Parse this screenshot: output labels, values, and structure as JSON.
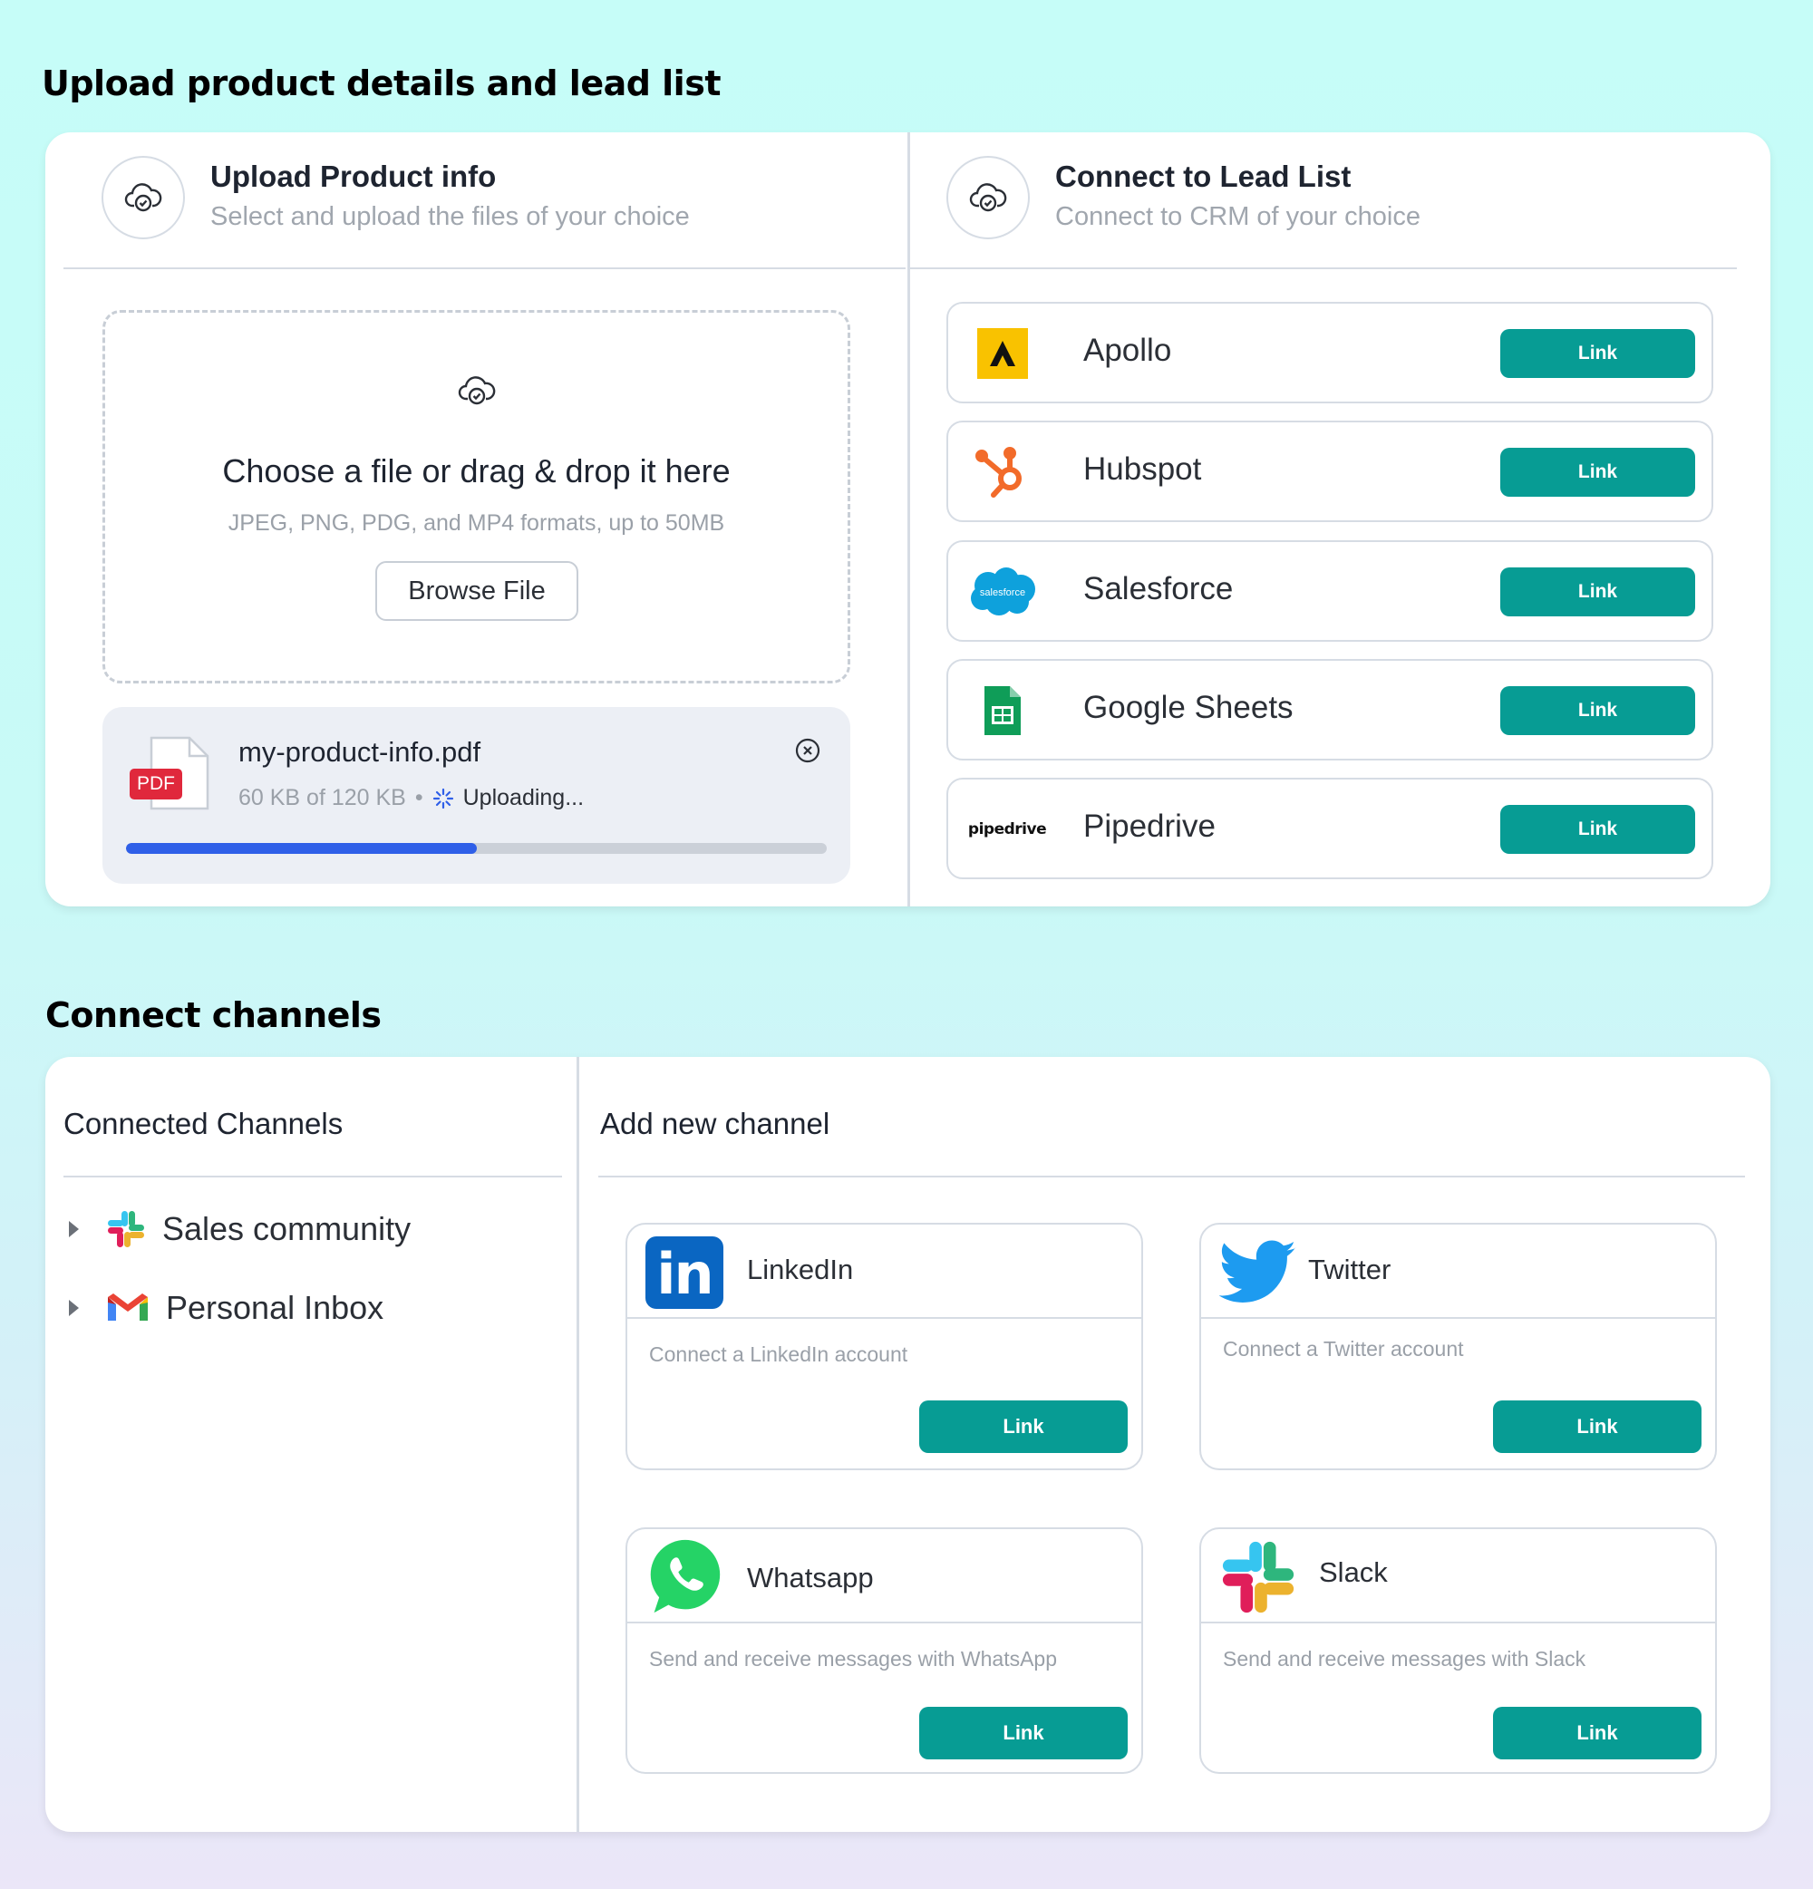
{
  "upload_section": {
    "title": "Upload product details and lead list",
    "product_panel": {
      "title": "Upload Product info",
      "subtitle": "Select and upload the files of your choice",
      "dropzone": {
        "title": "Choose a file or drag & drop it here",
        "hint": "JPEG, PNG, PDG, and MP4 formats, up to 50MB",
        "browse_label": "Browse File"
      },
      "file": {
        "badge": "PDF",
        "name": "my-product-info.pdf",
        "size_progress": "60 KB of 120 KB",
        "separator": "•",
        "status": "Uploading...",
        "progress_fraction": 0.5
      }
    },
    "lead_panel": {
      "title": "Connect to Lead List",
      "subtitle": "Connect to CRM of your choice",
      "crms": [
        {
          "name": "Apollo",
          "icon": "apollo-logo",
          "link_label": "Link"
        },
        {
          "name": "Hubspot",
          "icon": "hubspot-logo",
          "link_label": "Link"
        },
        {
          "name": "Salesforce",
          "icon": "salesforce-logo",
          "logo_text": "salesforce",
          "link_label": "Link"
        },
        {
          "name": "Google Sheets",
          "icon": "google-sheets-logo",
          "link_label": "Link"
        },
        {
          "name": "Pipedrive",
          "icon": "pipedrive-logo",
          "logo_text": "pipedrive",
          "link_label": "Link"
        }
      ]
    }
  },
  "channels_section": {
    "title": "Connect channels",
    "connected": {
      "title": "Connected Channels",
      "items": [
        {
          "label": "Sales community",
          "icon": "slack-logo"
        },
        {
          "label": "Personal Inbox",
          "icon": "gmail-logo"
        }
      ]
    },
    "add_new": {
      "title": "Add new channel",
      "channels": [
        {
          "name": "LinkedIn",
          "description": "Connect a LinkedIn account",
          "link_label": "Link",
          "icon": "linkedin-logo",
          "logo_text": "in"
        },
        {
          "name": "Twitter",
          "description": "Connect a Twitter account",
          "link_label": "Link",
          "icon": "twitter-logo"
        },
        {
          "name": "Whatsapp",
          "description": "Send and receive messages with WhatsApp",
          "link_label": "Link",
          "icon": "whatsapp-logo"
        },
        {
          "name": "Slack",
          "description": "Send and receive messages with Slack",
          "link_label": "Link",
          "icon": "slack-logo"
        }
      ]
    }
  },
  "colors": {
    "accent_teal": "#079c94",
    "progress_blue": "#2f5fe8",
    "pdf_red": "#e0283c",
    "background_mint": "#c6fdf8"
  }
}
